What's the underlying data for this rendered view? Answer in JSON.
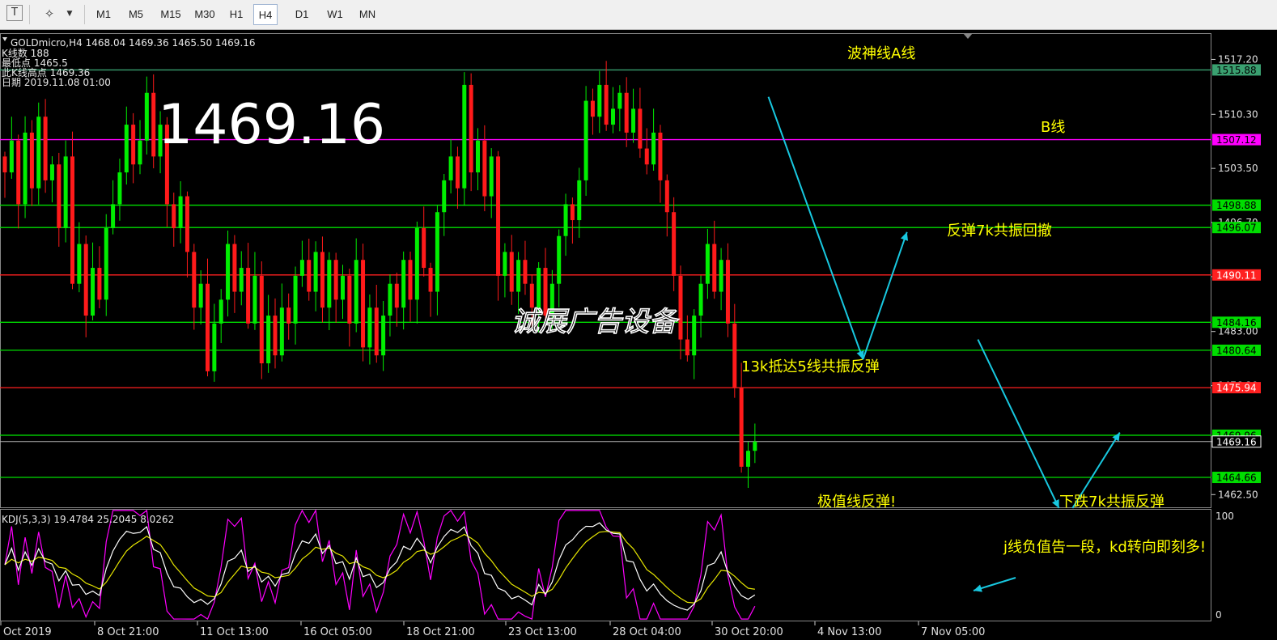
{
  "toolbar": {
    "cursor_icon": "T",
    "tools_icon": "✧",
    "dropdown_icon": "▼",
    "timeframes": [
      "M1",
      "M5",
      "M15",
      "M30",
      "H1",
      "H4",
      "D1",
      "W1",
      "MN"
    ],
    "active": "H4"
  },
  "header": {
    "line1": "GOLDmicro,H4  1468.04 1469.36 1465.50 1469.16",
    "line2": "K线数  188",
    "line3": "最低点  1465.5",
    "line4": "此K线高点  1469.36",
    "line5": "日期  2019.11.08 01:00"
  },
  "big_price": "1469.16",
  "watermark": "诚展广告设备",
  "annotations": {
    "wave_a": "波神线A线",
    "line_b": "B线",
    "rebound_7k": "反弹7k共振回撤",
    "k13": "13k抵达5线共振反弹",
    "extreme": "极值线反弹!",
    "fall_7k": "下跌7k共振反弹",
    "j_line": "j线负值告一段，kd转向即刻多!"
  },
  "colors": {
    "bull": "#00ee00",
    "bear": "#ff1a1a",
    "magenta": "#ff00ff",
    "yellow_text": "#ffff00",
    "cyan": "#18c8e0",
    "green_line": "#00dd00",
    "red_line": "#ff2020",
    "teal_line": "#3aa070"
  },
  "chart_data": {
    "type": "candlestick",
    "symbol": "GOLDmicro",
    "timeframe": "H4",
    "ylim": [
      1460.9,
      1520.5
    ],
    "y_ticks": [
      1517.2,
      1510.3,
      1503.5,
      1496.7,
      1489.9,
      1483.0,
      1476.2,
      1469.16,
      1462.5
    ],
    "x_labels": [
      "Oct 2019",
      "8 Oct 21:00",
      "11 Oct 13:00",
      "16 Oct 05:00",
      "18 Oct 21:00",
      "23 Oct 13:00",
      "28 Oct 04:00",
      "30 Oct 20:00",
      "4 Nov 13:00",
      "7 Nov 05:00"
    ],
    "levels": [
      {
        "value": 1515.88,
        "label": "1515.88",
        "kind": "teal"
      },
      {
        "value": 1507.12,
        "label": "1507.12",
        "kind": "magenta"
      },
      {
        "value": 1498.88,
        "label": "1498.88",
        "kind": "green"
      },
      {
        "value": 1496.07,
        "label": "1496.07",
        "kind": "green"
      },
      {
        "value": 1490.11,
        "label": "1490.11",
        "kind": "red"
      },
      {
        "value": 1484.16,
        "label": "1484.16",
        "kind": "green"
      },
      {
        "value": 1480.64,
        "label": "1480.64",
        "kind": "green"
      },
      {
        "value": 1475.94,
        "label": "1475.94",
        "kind": "red"
      },
      {
        "value": 1469.96,
        "label": "1469.96",
        "kind": "green"
      },
      {
        "value": 1469.16,
        "label": "1469.16",
        "kind": "current"
      },
      {
        "value": 1464.66,
        "label": "1464.66",
        "kind": "green"
      }
    ],
    "anchors": [
      1503,
      1507,
      1499,
      1508,
      1501,
      1510,
      1502,
      1504,
      1496,
      1505,
      1489,
      1494,
      1485,
      1491,
      1487,
      1496,
      1499,
      1503,
      1509,
      1504,
      1507,
      1513,
      1505,
      1509,
      1499,
      1496,
      1500,
      1493,
      1486,
      1489,
      1478,
      1484,
      1487,
      1494,
      1488,
      1491,
      1484,
      1490,
      1479,
      1485,
      1480,
      1486,
      1484,
      1490,
      1492,
      1488,
      1493,
      1486,
      1492,
      1487,
      1490,
      1484,
      1492,
      1481,
      1486,
      1480,
      1485,
      1489,
      1486,
      1492,
      1487,
      1496,
      1491,
      1488,
      1498,
      1502,
      1505,
      1501,
      1514,
      1503,
      1507,
      1500,
      1505,
      1490,
      1493,
      1488,
      1492,
      1489,
      1486,
      1491,
      1485,
      1489,
      1495,
      1499,
      1497,
      1502,
      1512,
      1510,
      1514,
      1509,
      1511,
      1513,
      1508,
      1511,
      1506,
      1504,
      1508,
      1502,
      1498,
      1490,
      1482,
      1480,
      1485,
      1489,
      1494,
      1488,
      1492,
      1484,
      1476,
      1466,
      1468,
      1469.16
    ],
    "kdj": {
      "title": "KDJ(5,3,3) 19.4784 25.2045 8.0262",
      "K": 19.4784,
      "D": 25.2045,
      "J": 8.0262,
      "ylim": [
        0,
        100
      ],
      "ticks": [
        100,
        0
      ]
    },
    "arrows": [
      {
        "from": [
          113,
          1512.5
        ],
        "to": [
          127,
          1479.5
        ]
      },
      {
        "from": [
          127,
          1479.5
        ],
        "to": [
          133.5,
          1495.5
        ]
      },
      {
        "from": [
          144,
          1482
        ],
        "to": [
          156,
          1460.8
        ]
      },
      {
        "from": [
          158,
          1460.8
        ],
        "to": [
          165,
          1470.3
        ]
      },
      {
        "from": [
          170,
          0
        ],
        "to": [
          170,
          0
        ],
        "kdj": true
      }
    ]
  }
}
